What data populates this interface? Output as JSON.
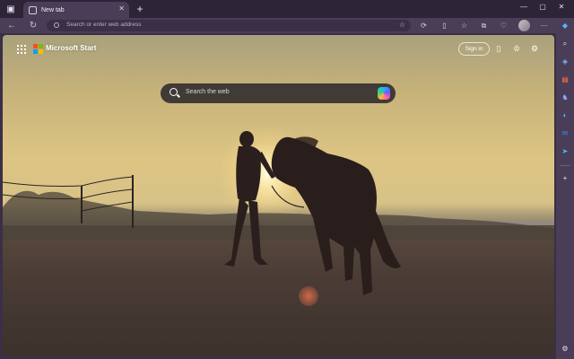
{
  "titlebar": {
    "tab_title": "New tab",
    "tab_close": "✕",
    "new_tab": "+",
    "window_controls": {
      "minimize": "—",
      "maximize": "▢",
      "close": "✕"
    }
  },
  "toolbar": {
    "back": "←",
    "refresh": "↻",
    "address_placeholder": "Search or enter web address",
    "favorite": "☆",
    "tools": [
      "⟳",
      "▯",
      "☆",
      "⧉",
      "♡",
      "⋯"
    ]
  },
  "page": {
    "brand": "Microsoft Start",
    "sign_in": "Sign in",
    "search_placeholder": "Search the web",
    "header_icons": [
      "phone-icon",
      "trophy-icon",
      "gear-icon"
    ]
  },
  "sidebar": {
    "items": [
      "search-icon",
      "tag-icon",
      "toolbox-icon",
      "games-icon",
      "copilot-icon",
      "outlook-icon",
      "send-icon"
    ],
    "add": "+",
    "settings": "⚙"
  },
  "colors": {
    "frame": "#4a3d57",
    "titlebar": "#2e2437",
    "search_bg": "#2d2a2c",
    "ms_red": "#f25022",
    "ms_green": "#7fba00",
    "ms_blue": "#00a4ef",
    "ms_yellow": "#ffb900"
  }
}
